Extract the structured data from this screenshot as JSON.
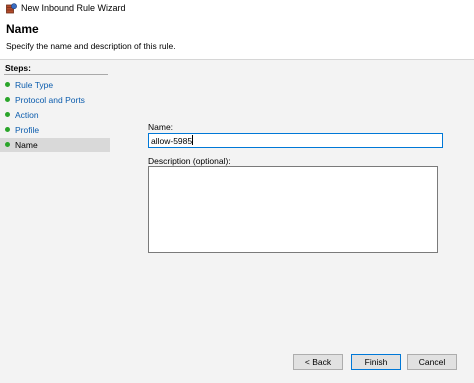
{
  "window": {
    "title": "New Inbound Rule Wizard",
    "icon": "firewall-rule-icon"
  },
  "header": {
    "title": "Name",
    "description": "Specify the name and description of this rule."
  },
  "sidebar": {
    "steps_label": "Steps:",
    "items": [
      {
        "label": "Rule Type",
        "state": "completed"
      },
      {
        "label": "Protocol and Ports",
        "state": "completed"
      },
      {
        "label": "Action",
        "state": "completed"
      },
      {
        "label": "Profile",
        "state": "completed"
      },
      {
        "label": "Name",
        "state": "current"
      }
    ]
  },
  "form": {
    "name_label": "Name:",
    "name_value": "allow-5985",
    "description_label": "Description (optional):",
    "description_value": ""
  },
  "buttons": {
    "back": "< Back",
    "finish": "Finish",
    "cancel": "Cancel"
  },
  "colors": {
    "accent": "#0078d7",
    "link": "#0b5cad",
    "step_dot": "#2aa52a",
    "panel_bg": "#f3f3f3"
  }
}
